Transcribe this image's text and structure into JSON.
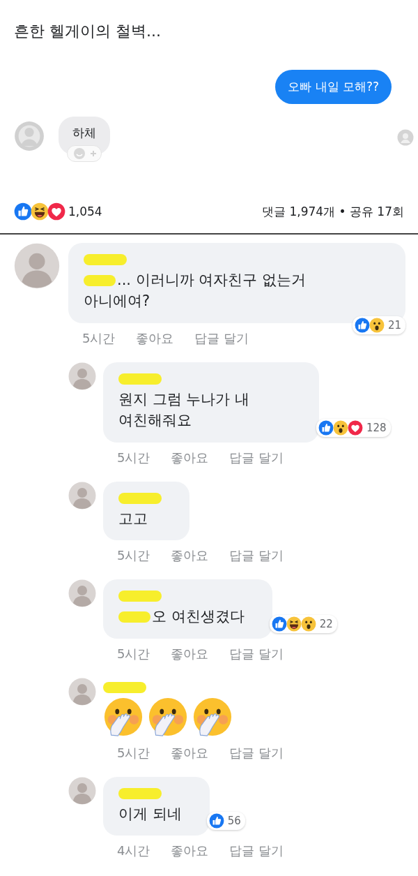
{
  "post": {
    "title": "흔한 헬게이의 철벽...",
    "sent_message": "오빠 내일 모해??",
    "received_message": "하체",
    "reactions": [
      {
        "kind": "like"
      },
      {
        "kind": "haha"
      },
      {
        "kind": "love"
      }
    ],
    "reaction_count": "1,054",
    "stats": "댓글 1,974개 • 공유 17회"
  },
  "comments": [
    {
      "kind": "text",
      "text": "... 이러니까 여자친구 없는거 아니에여?",
      "redacted_prefix": true,
      "time": "5시간",
      "like_action": "좋아요",
      "reply_action": "답글 달기",
      "reactions": [
        {
          "kind": "like"
        },
        {
          "kind": "wow"
        }
      ],
      "reaction_count": "21",
      "children": [
        {
          "kind": "text",
          "text": "원지 그럼 누나가 내 여친해줘요",
          "redacted_prefix": false,
          "time": "5시간",
          "like_action": "좋아요",
          "reply_action": "답글 달기",
          "reactions": [
            {
              "kind": "like"
            },
            {
              "kind": "wow"
            },
            {
              "kind": "love"
            }
          ],
          "reaction_count": "128"
        },
        {
          "kind": "text",
          "text": "고고",
          "redacted_prefix": false,
          "time": "5시간",
          "like_action": "좋아요",
          "reply_action": "답글 달기"
        },
        {
          "kind": "text",
          "text": "오 여친생겼다",
          "redacted_prefix": true,
          "time": "5시간",
          "like_action": "좋아요",
          "reply_action": "답글 달기",
          "reactions": [
            {
              "kind": "like"
            },
            {
              "kind": "haha"
            },
            {
              "kind": "wow"
            }
          ],
          "reaction_count": "22"
        },
        {
          "kind": "emoji",
          "emojis": [
            {
              "kind": "hand-over-mouth"
            },
            {
              "kind": "hand-over-mouth"
            },
            {
              "kind": "hand-over-mouth"
            }
          ],
          "time": "5시간",
          "like_action": "좋아요",
          "reply_action": "답글 달기"
        },
        {
          "kind": "text",
          "text": "이게 되네",
          "redacted_prefix": false,
          "time": "4시간",
          "like_action": "좋아요",
          "reply_action": "답글 달기",
          "reactions": [
            {
              "kind": "like"
            }
          ],
          "reaction_count": "56"
        }
      ]
    }
  ]
}
